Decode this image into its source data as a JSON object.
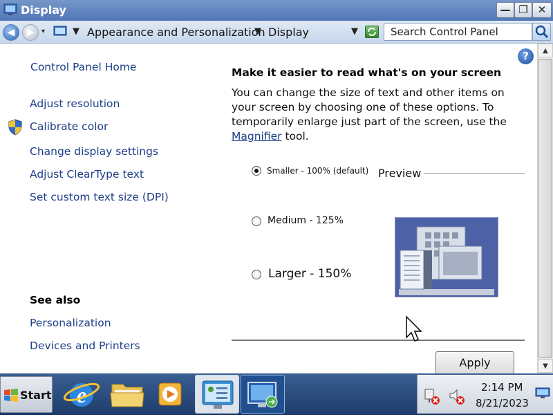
{
  "window": {
    "title": "Display"
  },
  "address_bar": {
    "crumbs": [
      "Appearance and Personalization",
      "Display"
    ],
    "search_placeholder": "Search Control Panel"
  },
  "sidebar": {
    "home_link": "Control Panel Home",
    "tasks": [
      "Adjust resolution",
      "Calibrate color",
      "Change display settings",
      "Adjust ClearType text",
      "Set custom text size (DPI)"
    ],
    "see_also_heading": "See also",
    "see_also": [
      "Personalization",
      "Devices and Printers"
    ]
  },
  "main": {
    "heading": "Make it easier to read what's on your screen",
    "description_before": "You can change the size of text and other items on your screen by choosing one of these options. To temporarily enlarge just part of the screen, use the ",
    "description_link": "Magnifier",
    "description_after": " tool.",
    "options": [
      {
        "label": "Smaller - 100% (default)",
        "selected": true
      },
      {
        "label": "Medium - 125%",
        "selected": false
      },
      {
        "label": "Larger - 150%",
        "selected": false
      }
    ],
    "preview_label": "Preview",
    "apply_label": "Apply"
  },
  "taskbar": {
    "start_label": "Start",
    "items": [
      "internet-explorer-icon",
      "folder-icon",
      "media-player-icon",
      "display-control-panel-icon",
      "remote-desktop-icon"
    ],
    "clock": {
      "time": "2:14 PM",
      "date": "8/21/2023"
    }
  }
}
